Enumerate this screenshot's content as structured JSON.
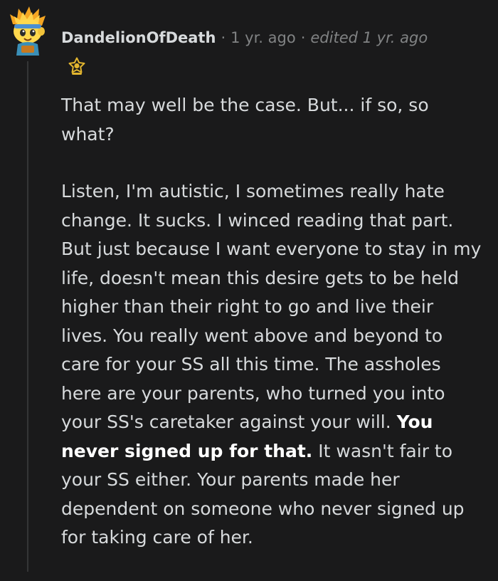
{
  "comment": {
    "author": "DandelionOfDeath",
    "separator": "·",
    "age": "1 yr. ago",
    "edited": "edited 1 yr. ago",
    "avatar_icon": "snoo-avatar-icon",
    "flair_icon": "award-icon",
    "paragraphs": [
      "That may well be the case. But... if so, so what?",
      "Listen, I'm autistic, I sometimes really hate change. It sucks. I winced reading that part. But just because I want everyone to stay in my life, doesn't mean this desire gets to be held higher than their right to go and live their lives. You really went above and beyond to care for your SS all this time. The assholes here are your parents, who turned you into your SS's caretaker against your will."
    ],
    "emphasis": "You never signed up for that.",
    "paragraph_tail": "It wasn't fair to your SS either. Your parents made her dependent on someone who never signed up for taking care of her."
  },
  "colors": {
    "background": "#1a1a1b",
    "text": "#d7dadc",
    "muted": "#818384",
    "thread_line": "#343536",
    "flair_gold": "#e2b52f"
  }
}
